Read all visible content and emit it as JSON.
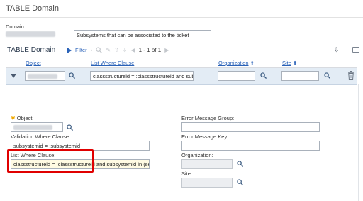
{
  "header": {
    "title": "TABLE Domain"
  },
  "domain": {
    "label": "Domain:",
    "description": "Subsystems that can be associated to the ticket"
  },
  "section": {
    "title": "TABLE Domain",
    "filter_label": "Filter",
    "pagination": "1 - 1 of 1"
  },
  "columns": {
    "object": "Object",
    "list_where": "List Where Clause",
    "organization": "Organization",
    "site": "Site"
  },
  "row": {
    "list_where_value": "classstructureid = :classstructureid and sub"
  },
  "detail": {
    "object_label": "Object:",
    "validation_label": "Validation Where Clause:",
    "validation_value": "subsystemid = :subsystemid",
    "list_where_label": "List Where Clause:",
    "list_where_value": "classstructureid = :classstructureid and subsystemid in (se",
    "error_group_label": "Error Message Group:",
    "error_key_label": "Error Message Key:",
    "organization_label": "Organization:",
    "site_label": "Site:"
  },
  "colors": {
    "accent": "#2a62b8",
    "highlight": "#e00000",
    "row_bg": "#e3ecf5"
  }
}
